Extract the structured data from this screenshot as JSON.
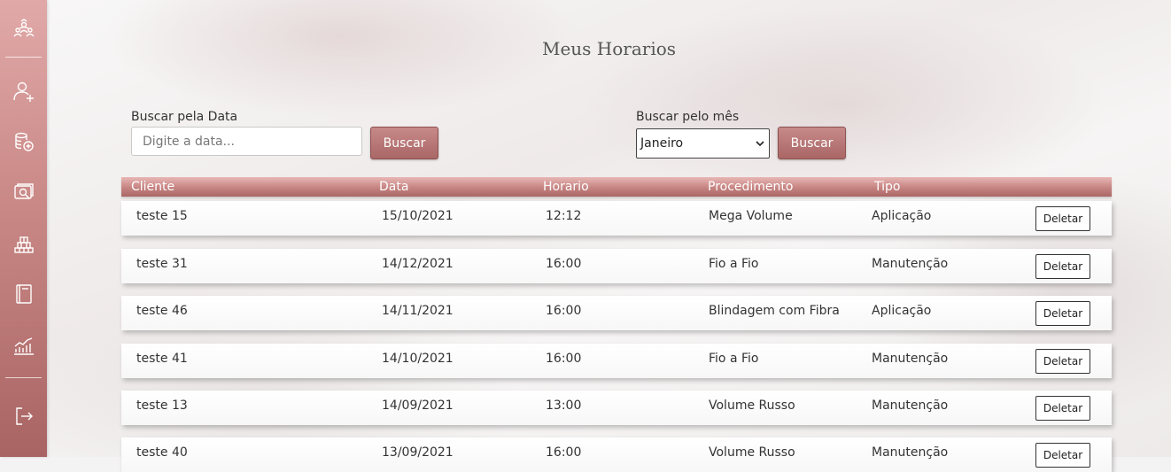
{
  "page_title": "Meus Horarios",
  "search_date": {
    "label": "Buscar pela Data",
    "placeholder": "Digite a data...",
    "button": "Buscar"
  },
  "search_month": {
    "label": "Buscar pelo mês",
    "selected": "Janeiro",
    "button": "Buscar"
  },
  "table": {
    "headers": [
      "Cliente",
      "Data",
      "Horario",
      "Procedimento",
      "Tipo"
    ],
    "delete_label": "Deletar",
    "rows": [
      {
        "cliente": "teste 15",
        "data": "15/10/2021",
        "horario": "12:12",
        "procedimento": "Mega Volume",
        "tipo": "Aplicação"
      },
      {
        "cliente": "teste 31",
        "data": "14/12/2021",
        "horario": "16:00",
        "procedimento": "Fio a Fio",
        "tipo": "Manutenção"
      },
      {
        "cliente": "teste 46",
        "data": "14/11/2021",
        "horario": "16:00",
        "procedimento": "Blindagem com Fibra",
        "tipo": "Aplicação"
      },
      {
        "cliente": "teste 41",
        "data": "14/10/2021",
        "horario": "16:00",
        "procedimento": "Fio a Fio",
        "tipo": "Manutenção"
      },
      {
        "cliente": "teste 13",
        "data": "14/09/2021",
        "horario": "13:00",
        "procedimento": "Volume Russo",
        "tipo": "Manutenção"
      },
      {
        "cliente": "teste 40",
        "data": "13/09/2021",
        "horario": "16:00",
        "procedimento": "Volume Russo",
        "tipo": "Manutenção"
      }
    ]
  },
  "sidebar": {
    "icons": [
      "users-group-icon",
      "add-user-icon",
      "add-coins-icon",
      "search-money-icon",
      "stack-icon",
      "book-icon",
      "chart-icon",
      "logout-icon"
    ]
  },
  "colors": {
    "accent": "#c07e7c",
    "accent_dark": "#a86463"
  }
}
